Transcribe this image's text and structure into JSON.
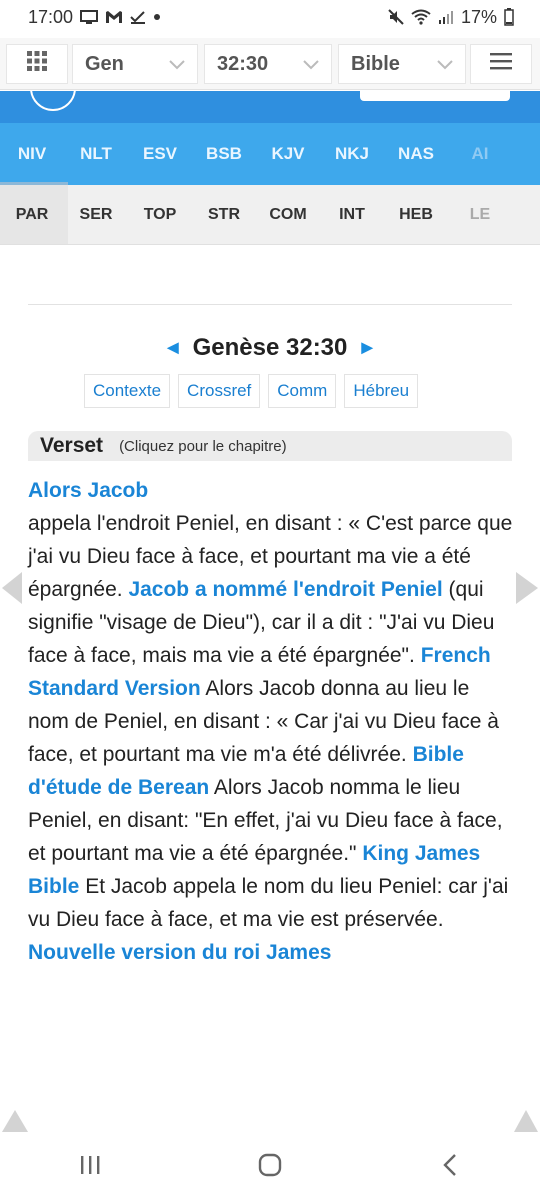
{
  "status": {
    "time": "17:00",
    "battery": "17%"
  },
  "topnav": {
    "book": "Gen",
    "chapter": "32:30",
    "bible": "Bible"
  },
  "translations": [
    "NIV",
    "NLT",
    "ESV",
    "BSB",
    "KJV",
    "NKJ",
    "NAS",
    "AI"
  ],
  "tools": [
    "PAR",
    "SER",
    "TOP",
    "STR",
    "COM",
    "INT",
    "HEB",
    "LE"
  ],
  "title": "Genèse 32:30",
  "links": [
    "Contexte",
    "Crossref",
    "Comm",
    "Hébreu"
  ],
  "verse_header": {
    "title": "Verset",
    "subtitle": "(Cliquez pour le chapitre)"
  },
  "verses": [
    {
      "version": "Alors Jacob",
      "text": "appela l'endroit Peniel, en disant : « C'est parce que j'ai vu Dieu face à face, et pourtant ma vie a été épargnée."
    },
    {
      "version": "Jacob a nommé l'endroit Peniel",
      "text": "(qui signifie \"visage de Dieu\"), car il a dit : \"J'ai vu Dieu face à face, mais ma vie a été épargnée\"."
    },
    {
      "version": "French Standard Version",
      "text": "Alors Jacob donna au lieu le nom de Peniel, en disant : « Car j'ai vu Dieu face à face, et pourtant ma vie m'a été délivrée."
    },
    {
      "version": "Bible d'étude de Berean",
      "text": "Alors Jacob nomma le lieu Peniel, en disant: \"En effet, j'ai vu Dieu face à face, et pourtant ma vie a été épargnée.\""
    },
    {
      "version": "King James Bible",
      "text": "Et Jacob appela le nom du lieu Peniel: car j'ai vu Dieu face à face, et ma vie est préservée."
    },
    {
      "version": "Nouvelle version du roi James",
      "text": ""
    }
  ],
  "colors": {
    "accent": "#2f8fdf",
    "tab_band": "#3ea8ec",
    "link": "#1a85d6"
  }
}
